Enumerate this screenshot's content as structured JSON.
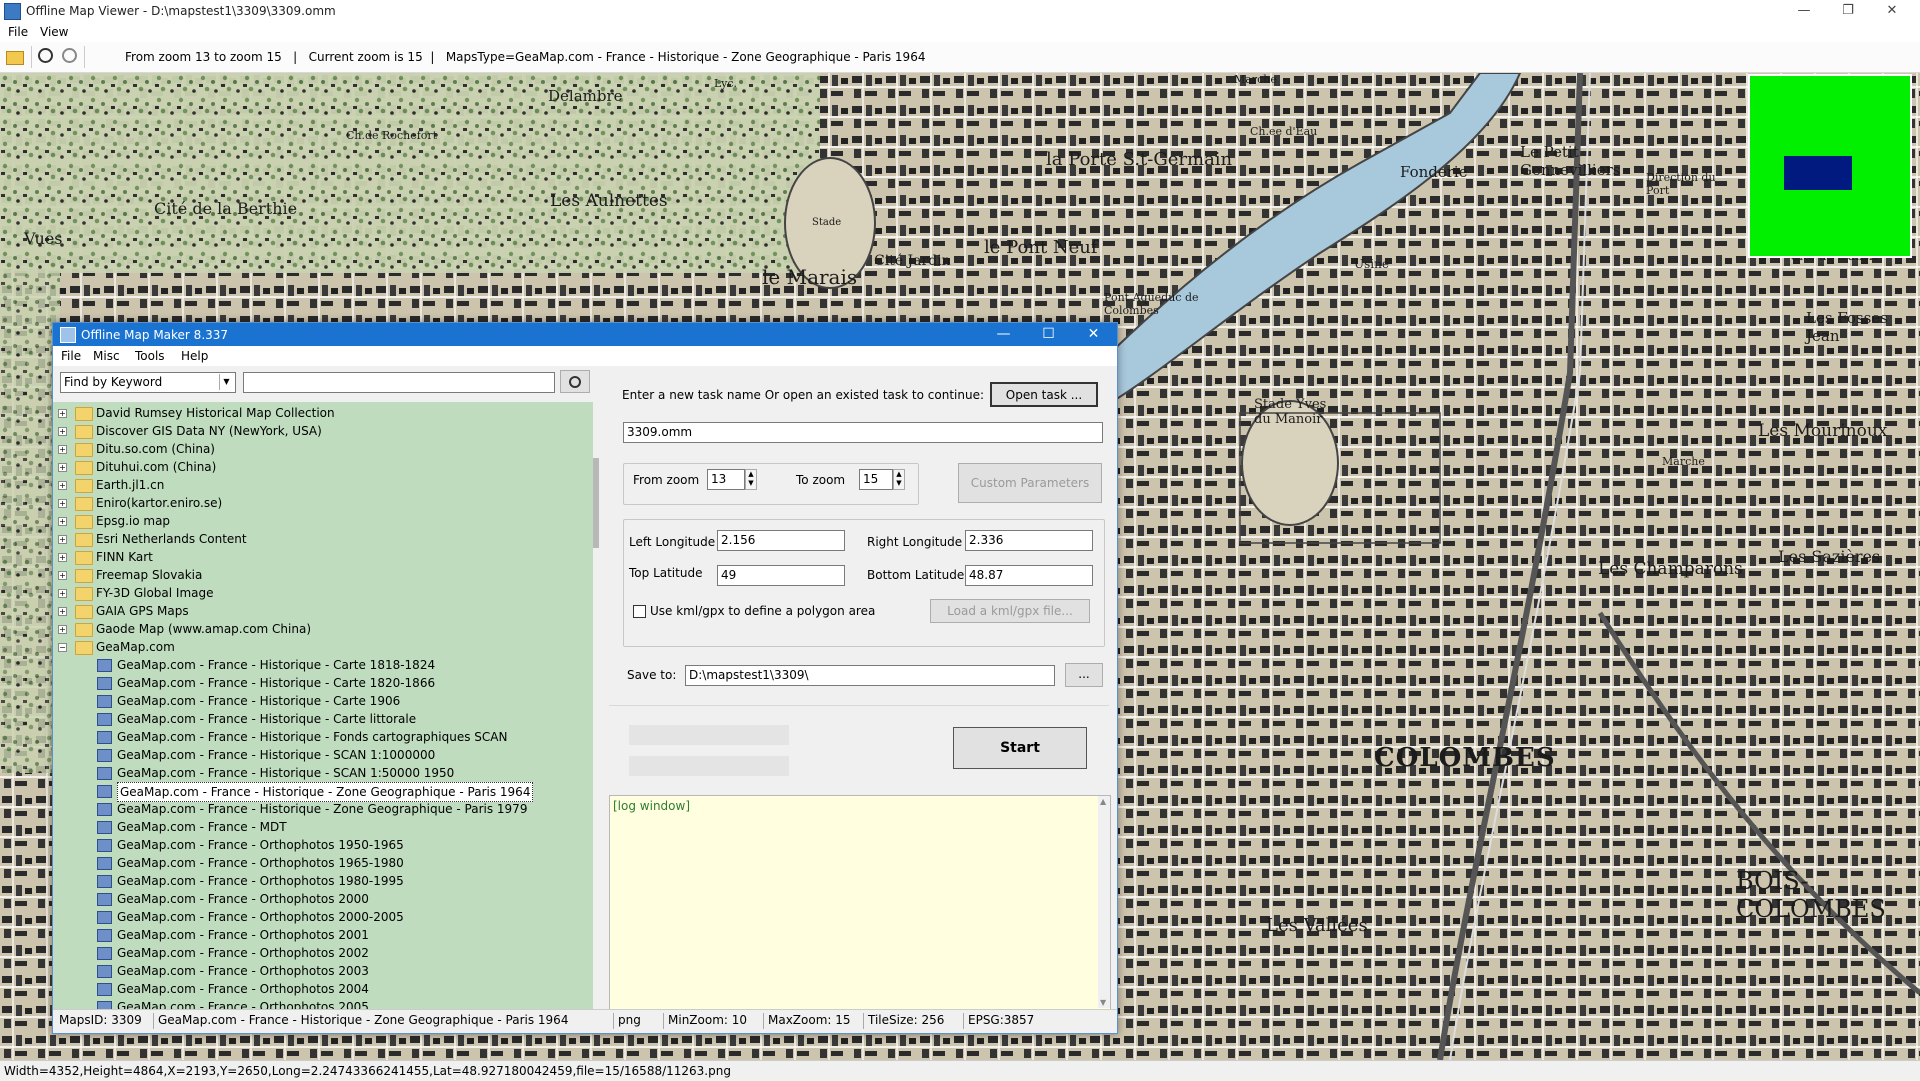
{
  "viewer": {
    "title": "Offline Map Viewer - D:\\mapstest1\\3309\\3309.omm",
    "menu": [
      "File",
      "View"
    ],
    "toolbar_text": "From zoom 13 to zoom 15   |   Current zoom is 15  |   MapsType=GeaMap.com - France - Historique - Zone Geographique - Paris 1964",
    "status": "Width=4352,Height=4864,X=2193,Y=2650,Long=2.24743366241455,Lat=48.927180042459,file=15/16588/11263.png",
    "window_buttons": [
      "—",
      "❐",
      "✕"
    ]
  },
  "map_labels": [
    "Delambre",
    "Ch.de Rochefort",
    "Lyc.",
    "Cité de la Berthie",
    "Les Aulnettes",
    "le Marais",
    "Cité Jardin",
    "le Pont Neuf",
    "la Porte S.t-Germain",
    "Le Petit Gennevilliers",
    "Fonderie",
    "Usine",
    "Stade",
    "Stade Yves du Manoir",
    "Les Mourinoux",
    "Les Champarons",
    "Les Sazières",
    "COLOMBES",
    "BOIS-COLOMBES",
    "Les Vallées",
    "Les Fosses Jean",
    "Vues",
    "Marche",
    "Marche",
    "Pont Aqueduc de Colombes",
    "Direction du Port",
    "Cité de transit",
    "Ch.ee d'Eau"
  ],
  "dialog": {
    "title": "Offline Map Maker 8.337",
    "menu": [
      "File",
      "Misc",
      "Tools",
      "Help"
    ],
    "search_mode": "Find by Keyword",
    "search_value": "",
    "tree_folders": [
      "David Rumsey Historical Map Collection",
      "Discover GIS Data NY (NewYork, USA)",
      "Ditu.so.com (China)",
      "Dituhui.com (China)",
      "Earth.jl1.cn",
      "Eniro(kartor.eniro.se)",
      "Epsg.io map",
      "Esri Netherlands Content",
      "FINN Kart",
      "Freemap Slovakia",
      "FY-3D Global Image",
      "GAIA GPS Maps",
      "Gaode Map (www.amap.com China)",
      "GeaMap.com"
    ],
    "tree_children": [
      "GeaMap.com - France - Historique - Carte 1818-1824",
      "GeaMap.com - France - Historique - Carte 1820-1866",
      "GeaMap.com - France - Historique - Carte 1906",
      "GeaMap.com - France - Historique - Carte littorale",
      "GeaMap.com - France - Historique - Fonds cartographiques SCAN",
      "GeaMap.com - France - Historique - SCAN 1:1000000",
      "GeaMap.com - France - Historique - SCAN 1:50000 1950",
      "GeaMap.com - France - Historique - Zone Geographique - Paris 1964",
      "GeaMap.com - France - Historique - Zone Geographique - Paris 1979",
      "GeaMap.com - France - MDT",
      "GeaMap.com - France - Orthophotos 1950-1965",
      "GeaMap.com - France - Orthophotos 1965-1980",
      "GeaMap.com - France - Orthophotos 1980-1995",
      "GeaMap.com - France - Orthophotos 2000",
      "GeaMap.com - France - Orthophotos 2000-2005",
      "GeaMap.com - France - Orthophotos 2001",
      "GeaMap.com - France - Orthophotos 2002",
      "GeaMap.com - France - Orthophotos 2003",
      "GeaMap.com - France - Orthophotos 2004",
      "GeaMap.com - France - Orthophotos 2005"
    ],
    "task_prompt": "Enter a new task name Or open an existed task to continue:",
    "open_task_label": "Open task ...",
    "task_name": "3309.omm",
    "from_zoom_label": "From zoom",
    "from_zoom": "13",
    "to_zoom_label": "To zoom",
    "to_zoom": "15",
    "custom_params_label": "Custom Parameters",
    "left_lon_label": "Left Longitude",
    "left_lon": "2.156",
    "right_lon_label": "Right Longitude",
    "right_lon": "2.336",
    "top_lat_label": "Top Latitude",
    "top_lat": "49",
    "bottom_lat_label": "Bottom Latitude",
    "bottom_lat": "48.87",
    "use_kml_label": "Use kml/gpx to define a polygon area",
    "load_kml_label": "Load a kml/gpx file...",
    "save_to_label": "Save to:",
    "save_to": "D:\\mapstest1\\3309\\",
    "browse_label": "...",
    "start_label": "Start",
    "log_text": "[log window]",
    "status": {
      "maps_id": "MapsID: 3309",
      "maps_name": "GeaMap.com - France - Historique - Zone Geographique - Paris 1964",
      "format": "png",
      "min_zoom": "MinZoom: 10",
      "max_zoom": "MaxZoom: 15",
      "tile_size": "TileSize: 256",
      "epsg": "EPSG:3857"
    }
  },
  "colors": {
    "title_blue": "#1a73d1",
    "tree_bg": "#bfdcbf",
    "log_bg": "#ffffe0",
    "overview_green": "#00f000",
    "overview_rect": "#001a80"
  }
}
